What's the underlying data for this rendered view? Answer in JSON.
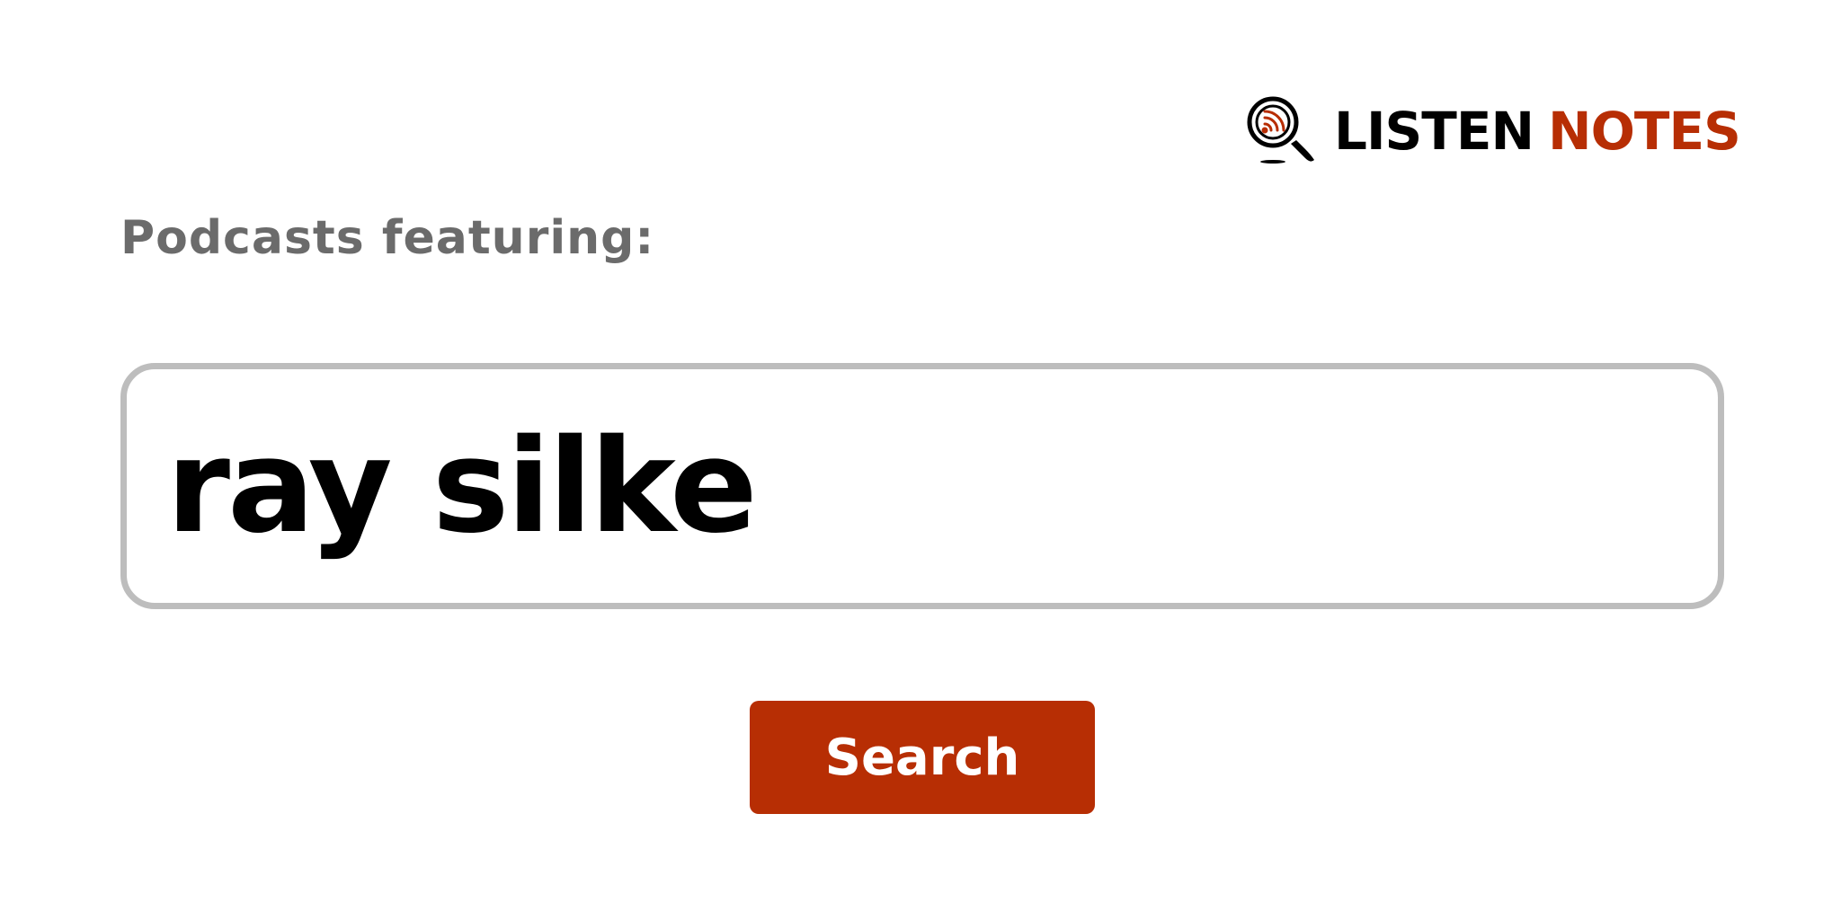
{
  "logo": {
    "word_1": "LISTEN",
    "word_2": "NOTES",
    "icon": "magnifier-podcast-icon",
    "colors": {
      "primary": "#000000",
      "accent": "#b72e04"
    }
  },
  "heading": "Podcasts featuring:",
  "search": {
    "value": "ray silke"
  },
  "button": {
    "label": "Search",
    "color": "#b72e04"
  }
}
